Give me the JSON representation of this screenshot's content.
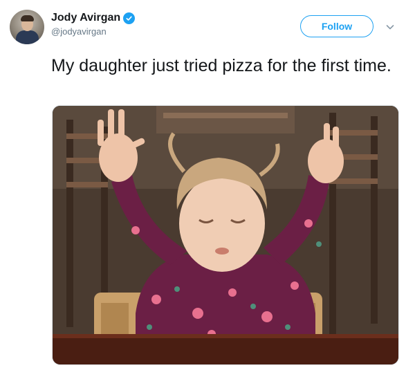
{
  "user": {
    "display_name": "Jody Avirgan",
    "handle": "@jodyavirgan",
    "verified": true
  },
  "actions": {
    "follow_label": "Follow"
  },
  "tweet": {
    "text": "My daughter just tried pizza for the first time."
  },
  "colors": {
    "accent": "#1da1f2",
    "text_primary": "#14171a",
    "text_secondary": "#657786"
  },
  "icons": [
    "verified-badge-icon",
    "chevron-down-icon"
  ]
}
